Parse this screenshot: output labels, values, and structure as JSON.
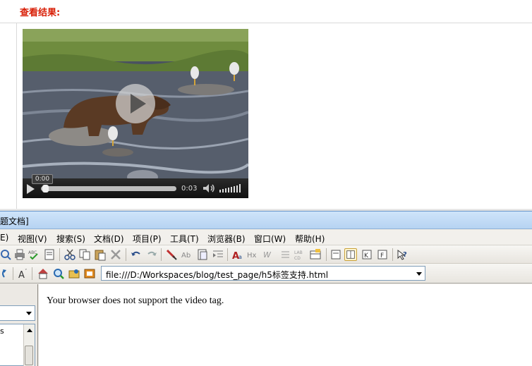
{
  "blog": {
    "result_title": "查看结果:"
  },
  "video": {
    "tooltip_time": "0:00",
    "duration": "0:03",
    "progress": 0.0
  },
  "ie": {
    "title": "题文档]",
    "menu": [
      "E)",
      "视图(V)",
      "搜索(S)",
      "文档(D)",
      "项目(P)",
      "工具(T)",
      "浏览器(B)",
      "窗口(W)",
      "帮助(H)"
    ],
    "address": "file:///D:/Workspaces/blog/test_page/h5标签支持.html",
    "side_list_item": "s",
    "fallback_text": "Your browser does not support the video tag."
  }
}
